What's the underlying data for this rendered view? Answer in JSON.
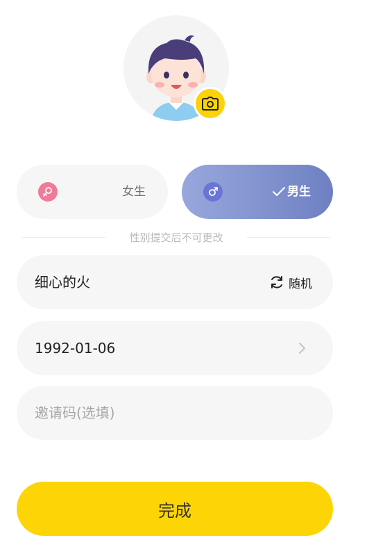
{
  "colors": {
    "accent_yellow": "#fdd507",
    "male_gradient_start": "#98a8dd",
    "male_gradient_end": "#6e80c2",
    "female_icon": "#f07a9a",
    "male_icon": "#6a76d3",
    "field_bg": "#f6f6f6"
  },
  "avatar": {
    "icon": "boy-avatar",
    "edit_icon": "camera-icon"
  },
  "gender": {
    "female_label": "女生",
    "male_label": "男生",
    "selected": "male",
    "selected_icon": "check-icon"
  },
  "gender_hint": "性别提交后不可更改",
  "nickname": {
    "value": "细心的火",
    "random_label": "随机",
    "random_icon": "refresh-icon"
  },
  "birthday": {
    "value": "1992-01-06",
    "icon": "chevron-right-icon"
  },
  "invite_code": {
    "placeholder": "邀请码(选填)"
  },
  "submit_label": "完成"
}
